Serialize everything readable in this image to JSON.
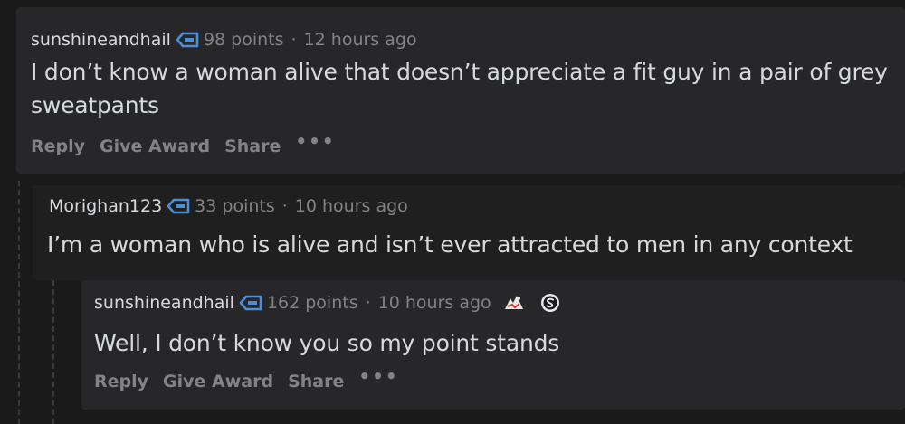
{
  "comments": [
    {
      "author": "sunshineandhail",
      "points": "98 points",
      "age": "12 hours ago",
      "body": "I don’t know a woman alive that doesn’t appreciate a fit guy in a pair of grey sweatpants",
      "actions": {
        "reply": "Reply",
        "award": "Give Award",
        "share": "Share",
        "more": "•••"
      }
    },
    {
      "author": "Morighan123",
      "points": "33 points",
      "age": "10 hours ago",
      "body": "I’m a woman who is alive and isn’t ever attracted to men in any context"
    },
    {
      "author": "sunshineandhail",
      "points": "162 points",
      "age": "10 hours ago",
      "body": "Well, I don’t know you so my point stands",
      "actions": {
        "reply": "Reply",
        "award": "Give Award",
        "share": "Share",
        "more": "•••"
      }
    }
  ],
  "meta_separator": "·",
  "icons": [
    "flair-tag-icon",
    "award-icon",
    "silver-award-icon"
  ]
}
